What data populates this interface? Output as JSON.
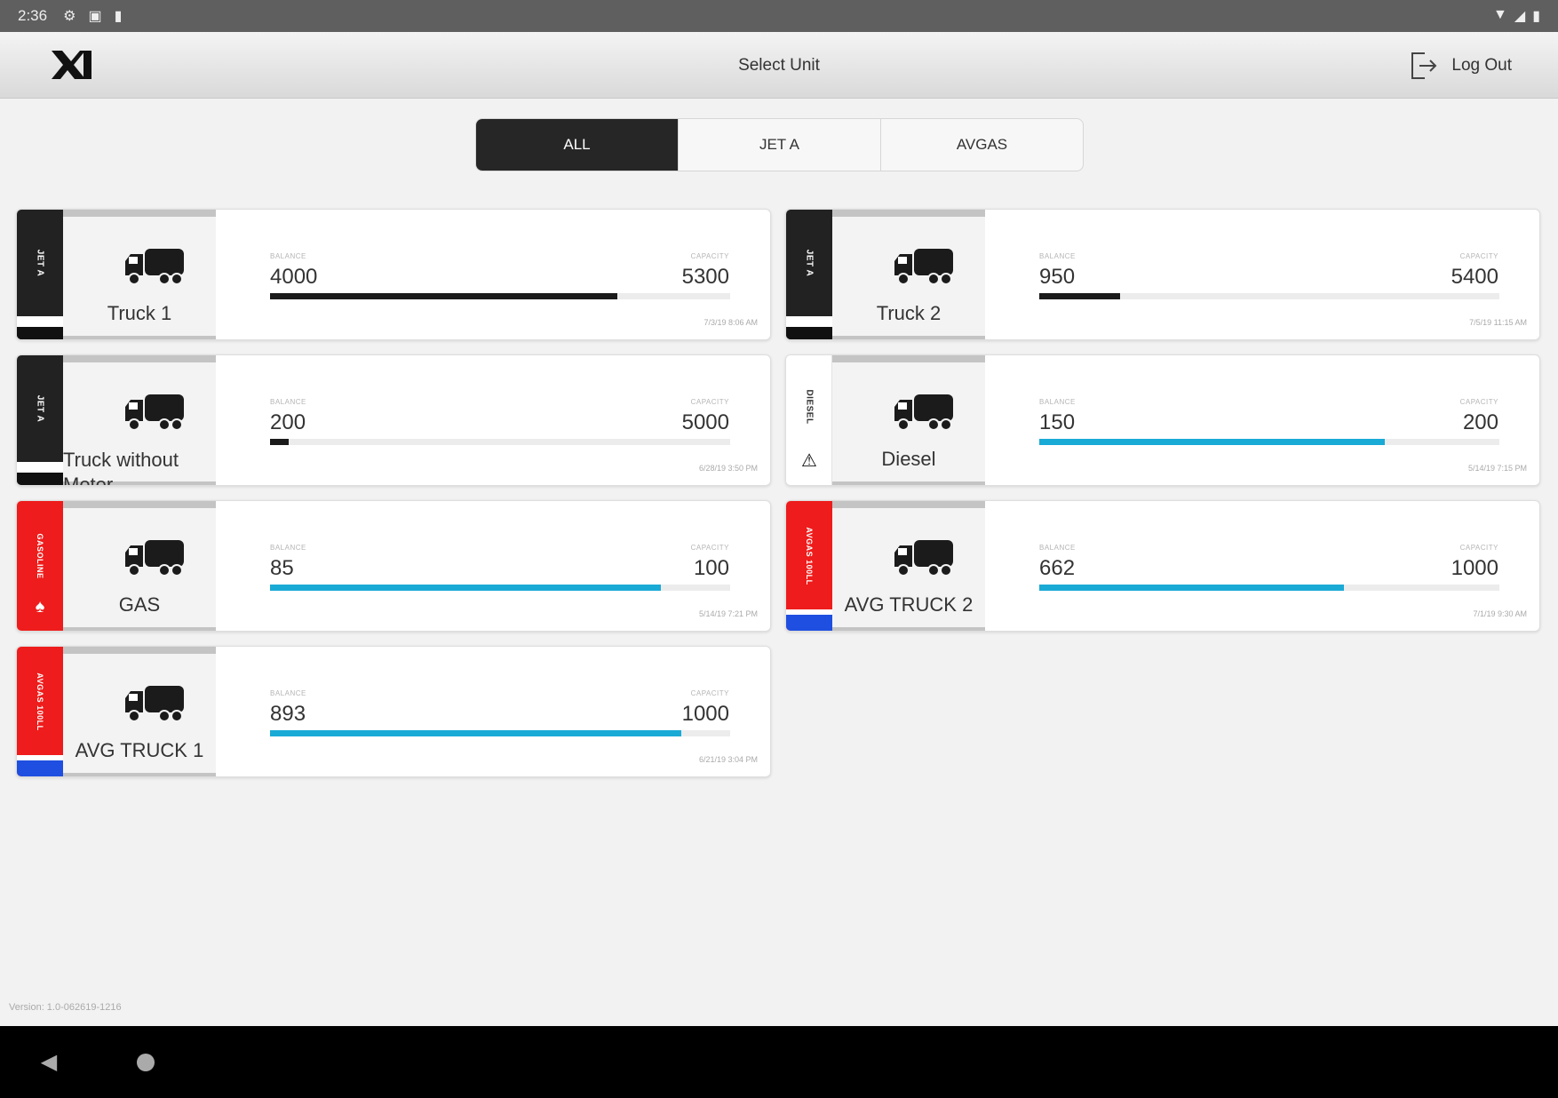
{
  "status_bar": {
    "time": "2:36"
  },
  "header": {
    "title": "Select Unit",
    "logout_label": "Log Out"
  },
  "tabs": [
    {
      "label": "ALL",
      "active": true
    },
    {
      "label": "JET A",
      "active": false
    },
    {
      "label": "AVGAS",
      "active": false
    }
  ],
  "units": [
    {
      "fuel": "JET A",
      "name": "Truck 1",
      "balance": "4000",
      "capacity": "5300",
      "fill_fraction": 0.755,
      "bar_color": "#1b1b1b",
      "timestamp": "7/3/19 8:06 AM"
    },
    {
      "fuel": "JET A",
      "name": "Truck 2",
      "balance": "950",
      "capacity": "5400",
      "fill_fraction": 0.176,
      "bar_color": "#1b1b1b",
      "timestamp": "7/5/19 11:15 AM"
    },
    {
      "fuel": "JET A",
      "name": "Truck without Meter",
      "balance": "200",
      "capacity": "5000",
      "fill_fraction": 0.04,
      "bar_color": "#1b1b1b",
      "timestamp": "6/28/19 3:50 PM"
    },
    {
      "fuel": "DIESEL",
      "name": "Diesel",
      "balance": "150",
      "capacity": "200",
      "fill_fraction": 0.75,
      "bar_color": "#1aaad6",
      "timestamp": "5/14/19 7:15 PM"
    },
    {
      "fuel": "GASOLINE",
      "name": "GAS",
      "balance": "85",
      "capacity": "100",
      "fill_fraction": 0.85,
      "bar_color": "#1aaad6",
      "timestamp": "5/14/19 7:21 PM"
    },
    {
      "fuel": "AVGAS 100LL",
      "name": "AVG TRUCK 2",
      "balance": "662",
      "capacity": "1000",
      "fill_fraction": 0.662,
      "bar_color": "#1aaad6",
      "timestamp": "7/1/19 9:30 AM"
    },
    {
      "fuel": "AVGAS 100LL",
      "name": "AVG TRUCK 1",
      "balance": "893",
      "capacity": "1000",
      "fill_fraction": 0.893,
      "bar_color": "#1aaad6",
      "timestamp": "6/21/19 3:04 PM"
    }
  ],
  "labels": {
    "balance": "BALANCE",
    "capacity": "CAPACITY"
  },
  "footer": {
    "version": "Version: 1.0-062619-1216"
  },
  "colors": {
    "jet_a": "#222222",
    "red_fuel": "#ee1c1c",
    "avgas_blue": "#1f4fe0",
    "bar_blue": "#1aaad6"
  }
}
